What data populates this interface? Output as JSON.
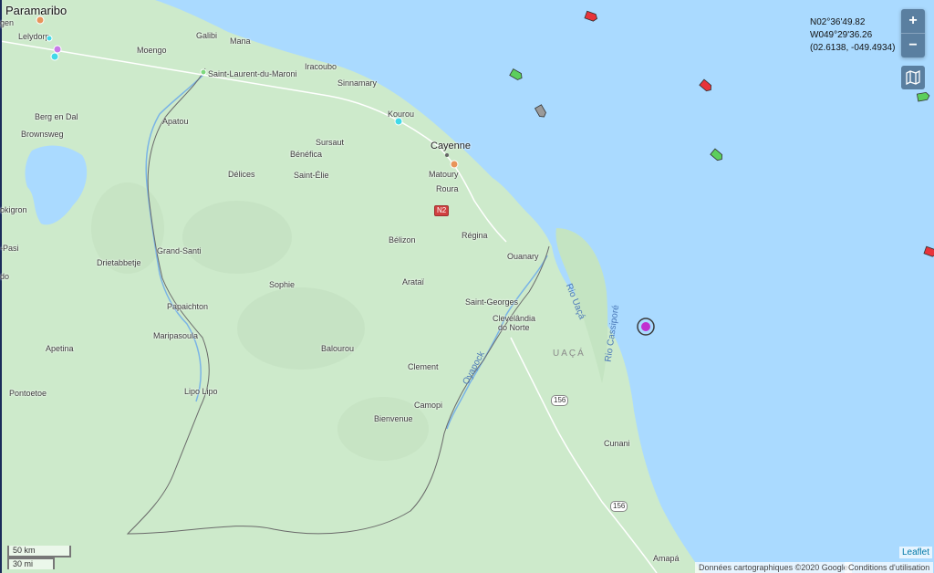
{
  "map": {
    "place_labels": [
      {
        "text": "Paramaribo",
        "class": "big"
      },
      {
        "text": "gen",
        "class": ""
      },
      {
        "text": "Lelydorp",
        "class": ""
      },
      {
        "text": "Moengo",
        "class": ""
      },
      {
        "text": "Galibi",
        "class": ""
      },
      {
        "text": "Mana",
        "class": ""
      },
      {
        "text": "Saint-Laurent-du-Maroni",
        "class": ""
      },
      {
        "text": "Iracoubo",
        "class": ""
      },
      {
        "text": "Sinnamary",
        "class": ""
      },
      {
        "text": "Kourou",
        "class": ""
      },
      {
        "text": "Cayenne",
        "class": "city"
      },
      {
        "text": "Matoury",
        "class": ""
      },
      {
        "text": "Roura",
        "class": ""
      },
      {
        "text": "Sursaut",
        "class": ""
      },
      {
        "text": "Bénéfica",
        "class": ""
      },
      {
        "text": "Saint-Élie",
        "class": ""
      },
      {
        "text": "Délices",
        "class": ""
      },
      {
        "text": "Apatou",
        "class": ""
      },
      {
        "text": "Berg en Dal",
        "class": ""
      },
      {
        "text": "Brownsweg",
        "class": ""
      },
      {
        "text": "okigron",
        "class": ""
      },
      {
        "text": "-Pasi",
        "class": ""
      },
      {
        "text": "do",
        "class": ""
      },
      {
        "text": "Grand-Santi",
        "class": ""
      },
      {
        "text": "Drietabbetje",
        "class": ""
      },
      {
        "text": "Sophie",
        "class": ""
      },
      {
        "text": "Papaichton",
        "class": ""
      },
      {
        "text": "Maripasoula",
        "class": ""
      },
      {
        "text": "Apetina",
        "class": ""
      },
      {
        "text": "Pontoetoe",
        "class": ""
      },
      {
        "text": "Lipo Lipo",
        "class": ""
      },
      {
        "text": "Bélizon",
        "class": ""
      },
      {
        "text": "Régina",
        "class": ""
      },
      {
        "text": "Arataï",
        "class": ""
      },
      {
        "text": "Ouanary",
        "class": ""
      },
      {
        "text": "Saint-Georges",
        "class": ""
      },
      {
        "text": "Clevelândia",
        "class": ""
      },
      {
        "text": "do Norte",
        "class": ""
      },
      {
        "text": "Balourou",
        "class": ""
      },
      {
        "text": "Clement",
        "class": ""
      },
      {
        "text": "Camopi",
        "class": ""
      },
      {
        "text": "Bienvenue",
        "class": ""
      },
      {
        "text": "Cunani",
        "class": ""
      },
      {
        "text": "Amapá",
        "class": ""
      }
    ],
    "river_labels": [
      "Oyapock",
      "Rio Uaçá",
      "Rio Cassiporé"
    ],
    "region_label": "UAÇÁ",
    "road_shields": [
      {
        "text": "N2",
        "style": "red"
      },
      {
        "text": "156",
        "style": "white"
      },
      {
        "text": "156",
        "style": "white"
      }
    ],
    "vessels": [
      {
        "color": "#e8333a",
        "name": "red-vessel-icon"
      },
      {
        "color": "#5ccf5c",
        "name": "green-vessel-icon"
      },
      {
        "color": "#e8333a",
        "name": "red-vessel-icon"
      },
      {
        "color": "#9a9a9a",
        "name": "gray-vessel-icon"
      },
      {
        "color": "#5ccf5c",
        "name": "green-vessel-icon"
      },
      {
        "color": "#5ccf5c",
        "name": "green-vessel-icon"
      },
      {
        "color": "#e8333a",
        "name": "red-vessel-icon"
      }
    ],
    "selected_vessel_color": "#c02fd0"
  },
  "controls": {
    "zoom_in": "+",
    "zoom_out": "−",
    "layers_icon": "map-layers-icon"
  },
  "coordinates": {
    "lat": "N02°36'49.82",
    "lon": "W049°29'36.26",
    "decimal": "(02.6138, -049.4934)"
  },
  "scale": {
    "km": "50 km",
    "mi": "30 mi"
  },
  "attribution": {
    "data": "Données cartographiques ©2020 Google",
    "terms": "Conditions d'utilisation",
    "leaflet": "Leaflet"
  },
  "colors": {
    "sea": "#aadaff",
    "land": "#cdeacb",
    "border": "#6a6a6a",
    "river": "#7ab4e6",
    "control": "#5a7fa0"
  }
}
